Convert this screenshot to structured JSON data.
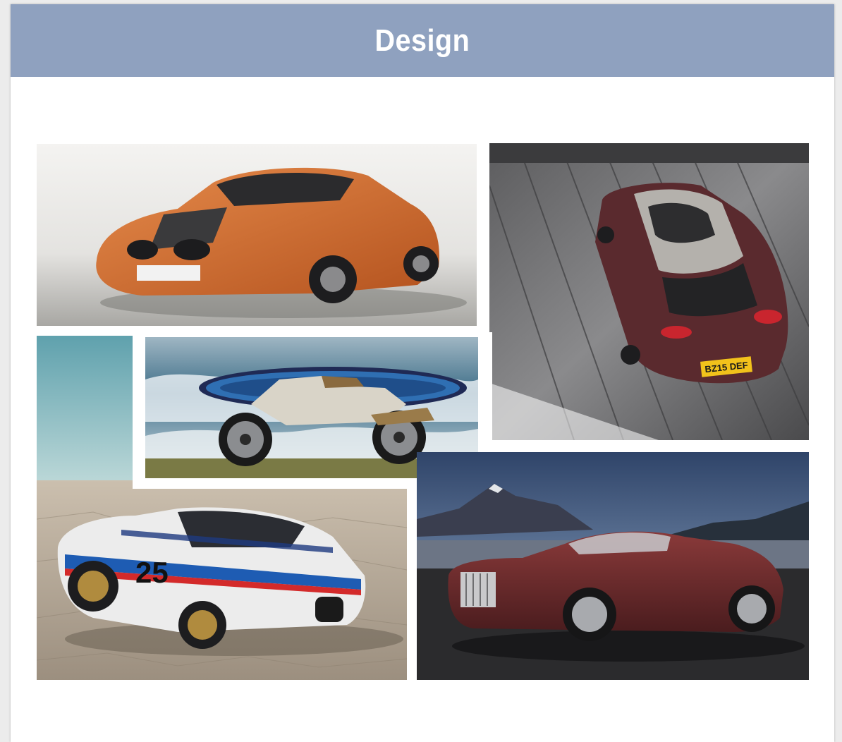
{
  "page": {
    "title": "Design"
  },
  "collage": {
    "photos": [
      {
        "subject": "Orange BMW concept roadster on white studio floor",
        "icon": "car-photo"
      },
      {
        "subject": "MINI Clubman seen from above on wooden planks, plate BZ15 DEF",
        "icon": "car-photo",
        "plate": "BZ15 DEF"
      },
      {
        "subject": "BMW motorcycle with blue surfboard on grassy cliff by the sea",
        "icon": "motorcycle-photo"
      },
      {
        "subject": "White BMW race coupe with blue and red stripes, number 25, on cracked desert",
        "icon": "car-photo",
        "number": "25"
      },
      {
        "subject": "Burgundy Rolls-Royce convertible in front of snow-capped mountain at dusk",
        "icon": "car-photo"
      }
    ]
  },
  "colors": {
    "header_bg": "#8fa1bf",
    "header_text": "#ffffff",
    "card_bg": "#ffffff"
  }
}
